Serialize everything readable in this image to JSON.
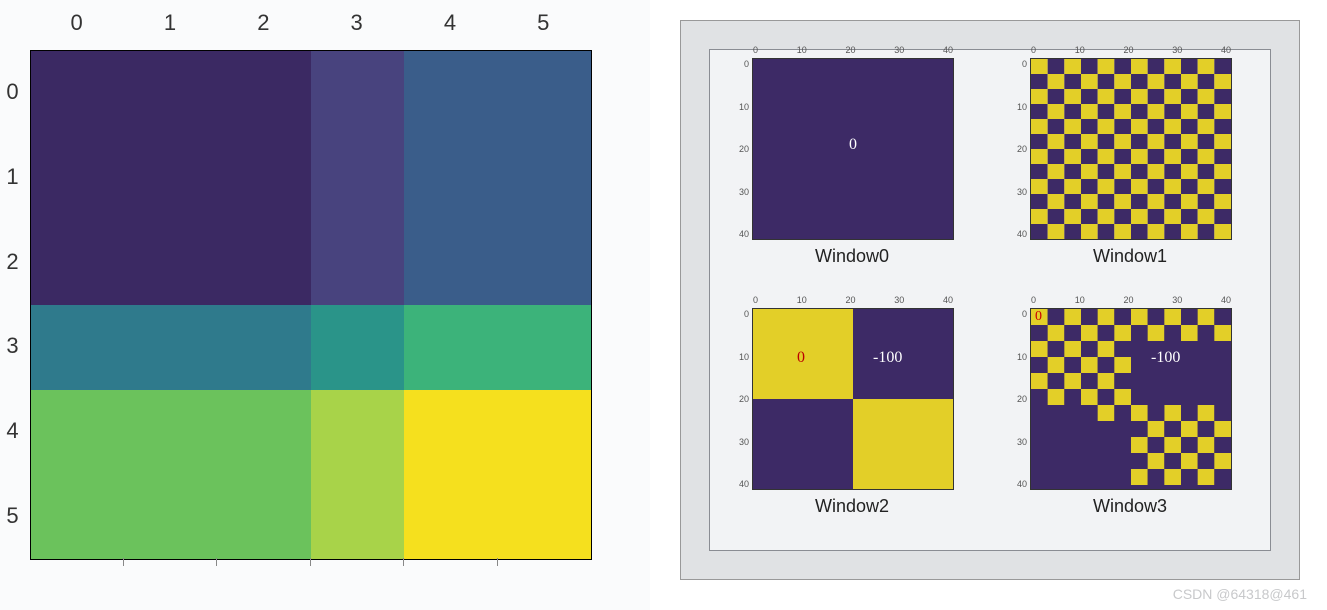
{
  "chart_data": [
    {
      "type": "heatmap",
      "title": "",
      "x_ticks": [
        "0",
        "1",
        "2",
        "3",
        "4",
        "5"
      ],
      "y_ticks": [
        "0",
        "1",
        "2",
        "3",
        "4",
        "5"
      ],
      "grid": [
        [
          0,
          0,
          0,
          1,
          2,
          2
        ],
        [
          0,
          0,
          0,
          1,
          2,
          2
        ],
        [
          0,
          0,
          0,
          1,
          2,
          2
        ],
        [
          3,
          3,
          3,
          4,
          5,
          5
        ],
        [
          6,
          6,
          6,
          7,
          8,
          8
        ],
        [
          6,
          6,
          6,
          7,
          8,
          8
        ]
      ],
      "colors": {
        "0": "#3b2963",
        "1": "#48437e",
        "2": "#3a5d8a",
        "3": "#2f7a8c",
        "4": "#2a9489",
        "5": "#3cb37a",
        "6": "#6bc25c",
        "7": "#a8d349",
        "8": "#f5e01e"
      }
    },
    {
      "type": "heatmap",
      "title": "Window0",
      "annotations": [
        {
          "text": "0",
          "x": 0.5,
          "y": 0.5,
          "color": "#fff"
        }
      ],
      "x_ticks": [
        "0",
        "10",
        "20",
        "30",
        "40"
      ],
      "y_ticks": [
        "0",
        "10",
        "20",
        "30",
        "40"
      ],
      "pattern": "solid",
      "fill": "#3d2a66"
    },
    {
      "type": "heatmap",
      "title": "Window1",
      "x_ticks": [
        "0",
        "10",
        "20",
        "30",
        "40"
      ],
      "y_ticks": [
        "0",
        "10",
        "20",
        "30",
        "40"
      ],
      "pattern": "checker",
      "cell_size": 4,
      "colors": [
        "#3d2a66",
        "#e3cf28"
      ]
    },
    {
      "type": "heatmap",
      "title": "Window2",
      "annotations": [
        {
          "text": "0",
          "x": 0.25,
          "y": 0.25,
          "color": "#b00"
        },
        {
          "text": "-100",
          "x": 0.75,
          "y": 0.25,
          "color": "#fff"
        }
      ],
      "x_ticks": [
        "0",
        "10",
        "20",
        "30",
        "40"
      ],
      "y_ticks": [
        "0",
        "10",
        "20",
        "30",
        "40"
      ],
      "pattern": "2x2",
      "blocks": [
        [
          "#e3cf28",
          "#3d2a66"
        ],
        [
          "#3d2a66",
          "#e3cf28"
        ]
      ]
    },
    {
      "type": "heatmap",
      "title": "Window3",
      "annotations": [
        {
          "text": "0",
          "x": 0.05,
          "y": 0.05,
          "color": "#c00"
        },
        {
          "text": "-100",
          "x": 0.75,
          "y": 0.25,
          "color": "#fff"
        }
      ],
      "x_ticks": [
        "0",
        "10",
        "20",
        "30",
        "40"
      ],
      "y_ticks": [
        "0",
        "10",
        "20",
        "30",
        "40"
      ],
      "pattern": "mixed"
    }
  ],
  "heatmap": {
    "xticks": [
      "0",
      "1",
      "2",
      "3",
      "4",
      "5"
    ],
    "yticks": [
      "0",
      "1",
      "2",
      "3",
      "4",
      "5"
    ]
  },
  "windows": {
    "w0": {
      "title": "Window0",
      "anno": "0",
      "ticks": [
        "0",
        "10",
        "20",
        "30",
        "40"
      ]
    },
    "w1": {
      "title": "Window1",
      "ticks": [
        "0",
        "10",
        "20",
        "30",
        "40"
      ]
    },
    "w2": {
      "title": "Window2",
      "anno1": "0",
      "anno2": "-100",
      "ticks": [
        "0",
        "10",
        "20",
        "30",
        "40"
      ]
    },
    "w3": {
      "title": "Window3",
      "anno1": "0",
      "anno2": "-100",
      "ticks": [
        "0",
        "10",
        "20",
        "30",
        "40"
      ]
    }
  },
  "watermark": "CSDN @64318@461"
}
